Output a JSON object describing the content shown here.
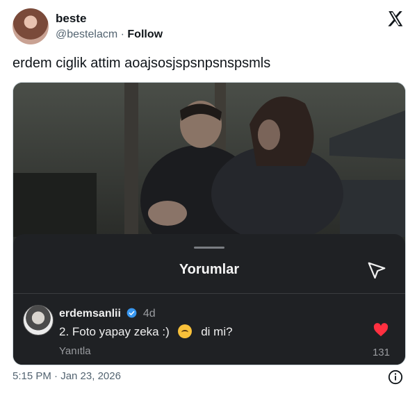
{
  "author": {
    "name": "beste",
    "handle": "@bestelacm",
    "separator": "·",
    "follow_label": "Follow"
  },
  "tweet": {
    "text": "erdem ciglik attim aoajsosjspsnpsnspsmls",
    "timestamp": "5:15 PM · Jan 23, 2026"
  },
  "embedded": {
    "sheet_title": "Yorumlar",
    "comment": {
      "username": "erdemsanlii",
      "time": "4d",
      "text_before": "2. Foto yapay zeka :)",
      "text_after": "di mi?",
      "reply_label": "Yanıtla",
      "likes": "131"
    }
  },
  "colors": {
    "sheet_bg": "#1f2124",
    "heart": "#ff3040",
    "verified": "#3897f0"
  },
  "icons": [
    "x-logo-icon",
    "send-icon",
    "verified-badge-icon",
    "upside-down-face-emoji",
    "heart-icon",
    "info-icon"
  ]
}
